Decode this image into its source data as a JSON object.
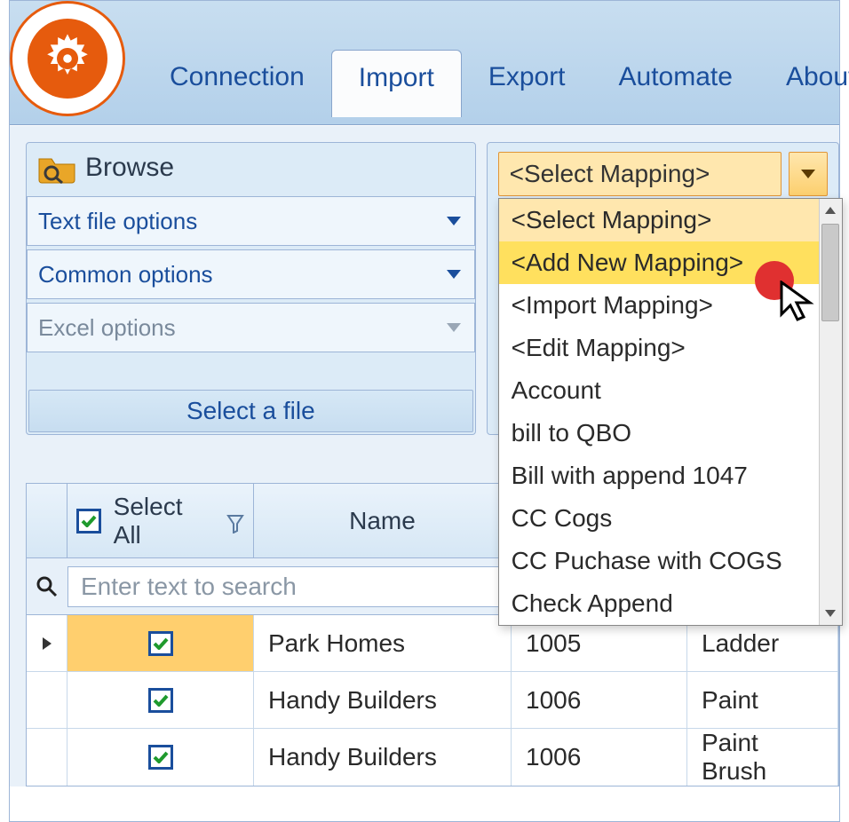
{
  "menu": {
    "connection": "Connection",
    "import": "Import",
    "export": "Export",
    "automate": "Automate",
    "about": "About"
  },
  "file_panel": {
    "browse_label": "Browse",
    "text_file_options": "Text file options",
    "common_options": "Common options",
    "excel_options": "Excel options",
    "footer": "Select a file"
  },
  "mapping": {
    "selected": "<Select Mapping>",
    "options": [
      "<Select Mapping>",
      "<Add New Mapping>",
      "<Import Mapping>",
      "<Edit Mapping>",
      "Account",
      "bill to QBO",
      "Bill with append 1047",
      "CC Cogs",
      "CC Puchase with COGS",
      "Check Append"
    ],
    "highlight_index": 1,
    "selected_index": 0
  },
  "grid": {
    "select_all": "Select All",
    "name": "Name",
    "search_placeholder": "Enter text to search",
    "rows": [
      {
        "checked": true,
        "name": "Park Homes",
        "id": "1005",
        "item": "Ladder",
        "active": true
      },
      {
        "checked": true,
        "name": "Handy Builders",
        "id": "1006",
        "item": "Paint",
        "active": false
      },
      {
        "checked": true,
        "name": "Handy Builders",
        "id": "1006",
        "item": "Paint Brush",
        "active": false
      }
    ]
  }
}
